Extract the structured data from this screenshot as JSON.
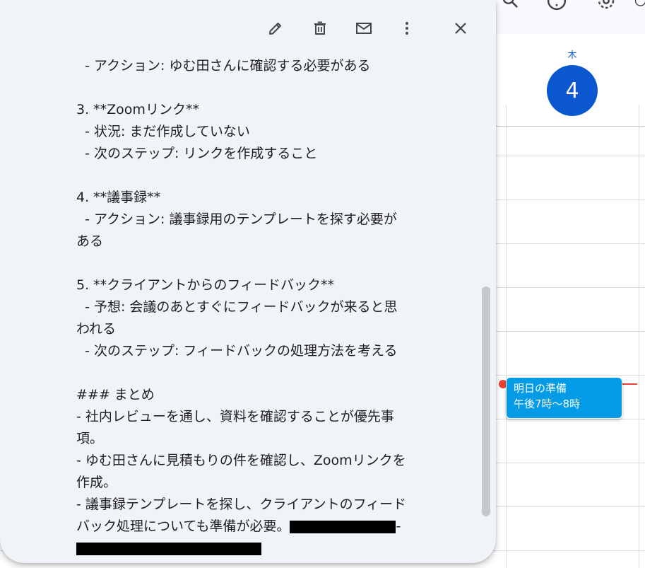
{
  "calendar": {
    "day_name": "木",
    "day_number": "4",
    "event": {
      "title": "明日の準備",
      "time": "午後7時〜8時",
      "color": "#039be5"
    },
    "accent_color": "#0b57d0",
    "now_line_color": "#ea4335"
  },
  "top_icons": [
    "search-icon",
    "help-icon",
    "settings-icon"
  ],
  "popover": {
    "toolbar_icons": [
      "edit-icon",
      "delete-icon",
      "email-icon",
      "more-vert-icon",
      "close-icon"
    ],
    "description_lines": [
      "  - アクション: ゆむ田さんに確認する必要がある",
      "",
      "3. **Zoomリンク**",
      "  - 状況: まだ作成していない",
      "  - 次のステップ: リンクを作成すること",
      "",
      "4. **議事録**",
      "  - アクション: 議事録用のテンプレートを探す必要が",
      "ある",
      "",
      "5. **クライアントからのフィードバック**",
      "  - 予想: 会議のあとすぐにフィードバックが来ると思",
      "われる",
      "  - 次のステップ: フィードバックの処理方法を考える",
      "",
      "### まとめ",
      "- 社内レビューを通し、資料を確認することが優先事",
      "項。",
      "- ゆむ田さんに見積もりの件を確認し、Zoomリンクを",
      "作成。",
      "- 議事録テンプレートを探し、クライアントのフィード",
      "バック処理についても準備が必要。"
    ],
    "redacted_tail": "-"
  }
}
